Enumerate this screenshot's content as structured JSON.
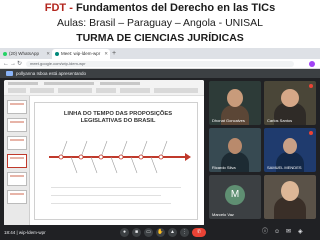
{
  "banner": {
    "prefix": "FDT - ",
    "title": "Fundamentos del Derecho en las TICs",
    "classrooms": "Aulas: Brasil – Paraguay – Angola - UNISAL",
    "group": "TURMA DE CIENCIAS JURÍDICAS"
  },
  "browser": {
    "tabs": [
      {
        "label": "(20) WhatsApp"
      },
      {
        "label": "Meet: wip-ldem-wpr"
      }
    ],
    "url": "meet.google.com/wip-ldem-wpr"
  },
  "meet": {
    "presenting_label": "pollyanna Isboa está apresentando",
    "slide_title": "LINHA DO TEMPO DAS PROPOSIÇÕES LEGISLATIVAS DO BRASIL",
    "participants": [
      {
        "name": "Dhonat Goncalves"
      },
      {
        "name": "Carlos Santos"
      },
      {
        "name": "Ricardo Silva"
      },
      {
        "name": "SAMUEL MENDES"
      },
      {
        "name": "Marcelo Vaz"
      },
      {
        "name": ""
      }
    ],
    "time_code": "18:44  |  wip-ldem-wpr"
  },
  "colors": {
    "accent": "#b3261e",
    "meet_bg": "#202124",
    "leave": "#ea4335"
  }
}
